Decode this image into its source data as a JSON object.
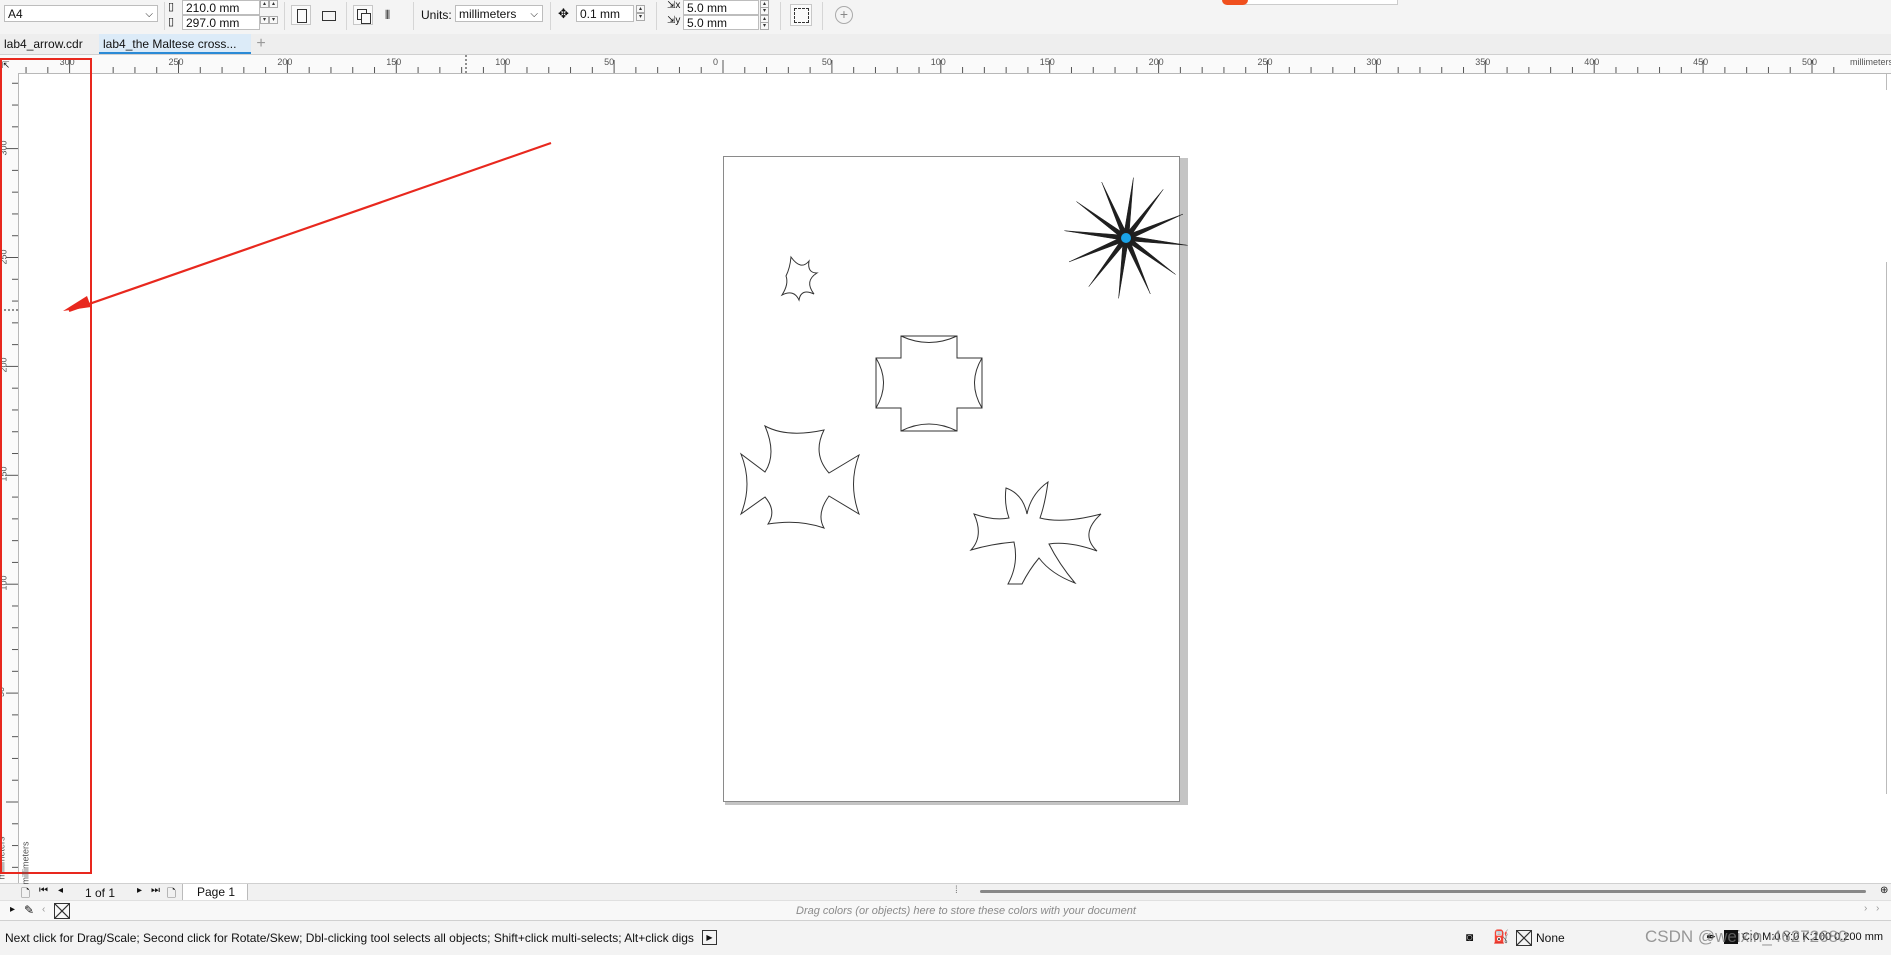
{
  "property_bar": {
    "page_size": "A4",
    "width": "210.0 mm",
    "height": "297.0 mm",
    "units_label": "Units:",
    "units_value": "millimeters",
    "nudge": "0.1 mm",
    "dup_x": "5.0 mm",
    "dup_y": "5.0 mm"
  },
  "tabs": [
    {
      "label": "lab4_arrow.cdr"
    },
    {
      "label": "lab4_the Maltese cross..."
    }
  ],
  "rulers": {
    "horizontal_ticks": [
      "300",
      "250",
      "200",
      "150",
      "100",
      "50",
      "0",
      "50",
      "100",
      "150",
      "200",
      "250",
      "300",
      "350",
      "400",
      "450",
      "500"
    ],
    "horizontal_unit": "millimeters",
    "vertical_ticks": [
      "300",
      "250",
      "200",
      "150",
      "100",
      "50",
      "0"
    ],
    "vertical_unit": "millimeters"
  },
  "page_nav": {
    "counter": "1 of 1",
    "page_tab": "Page 1"
  },
  "palette": {
    "hint": "Drag colors (or objects) here to store these colors with your document"
  },
  "status": {
    "message": "Next click for Drag/Scale; Second click for Rotate/Skew; Dbl-clicking tool selects all objects; Shift+click multi-selects; Alt+click digs",
    "fill": "None",
    "outline_info": "C:0 M:0 Y:0 K:100 0.200 mm",
    "watermark": "CSDN @weixin_46272680"
  },
  "colors": {
    "annotation_red": "#e8281e",
    "star_fill": "#1f1f1f",
    "star_center": "#1aa3e8",
    "accent": "#2a8ad6"
  }
}
